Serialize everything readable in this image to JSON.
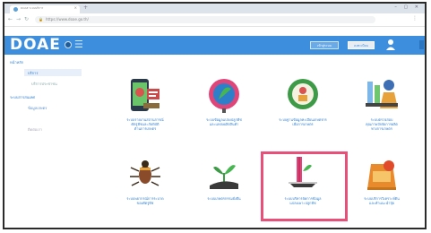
{
  "browser": {
    "tab_title": "DOAE ระบบบริการ",
    "tab_close": "×",
    "new_tab": "+",
    "address": "https://www.doae.go.th/",
    "window_controls": "– ▢ ✕",
    "nav_back": "←",
    "nav_forward": "→",
    "nav_reload": "↻",
    "menu": "⋮"
  },
  "header": {
    "logo_text": "DOAE",
    "menu_icon": "☰",
    "button_primary": "เข้าสู่ระบบ",
    "button_secondary": "ลงทะเบียน",
    "accent_color": "#3e8ede"
  },
  "sidebar": {
    "section_title": "หน้าหลัก",
    "active_item": "บริการ",
    "sub_item": "บริการประชาชน",
    "group_title": "ระบบสารสนเทศ",
    "group_item": "ข้อมูลเกษตร",
    "footer_item": "ติดต่อเรา"
  },
  "cards": [
    {
      "icon": "phone-plant-doctor-icon",
      "lines": [
        "ระบบรายงานสถานการณ์",
        "ศัตรูพืชและภัยพิบัติ",
        "ด้านการเกษตร"
      ]
    },
    {
      "icon": "globe-leaf-icon",
      "lines": [
        "ระบบข้อมูลแปลงปลูกพืช",
        "และแหล่งผลิตสินค้า"
      ]
    },
    {
      "icon": "farmer-registry-badge-icon",
      "lines": [
        "ระบบฐานข้อมูลทะเบียนเกษตรกร",
        "เพื่อการเกษตร"
      ]
    },
    {
      "icon": "lab-chemistry-icon",
      "lines": [
        "ระบบตรวจสอบ",
        "คุณภาพปัจจัยการผลิต",
        "ทางการเกษตร"
      ]
    },
    {
      "icon": "insect-pest-icon",
      "lines": [
        "ระบบพยากรณ์การระบาด",
        "ของศัตรูพืช"
      ]
    },
    {
      "icon": "hand-seedling-icon",
      "lines": [
        "ระบบเกษตรกรรมยั่งยืน"
      ]
    },
    {
      "icon": "plant-growth-chart-icon",
      "lines": [
        "ระบบบริหารจัดการข้อมูล",
        "แปลงเพาะปลูกพืช"
      ]
    },
    {
      "icon": "fertilizer-bag-icon",
      "lines": [
        "ระบบบริการวิเคราะห์ดิน",
        "และคำแนะนำปุ๋ย"
      ]
    }
  ]
}
